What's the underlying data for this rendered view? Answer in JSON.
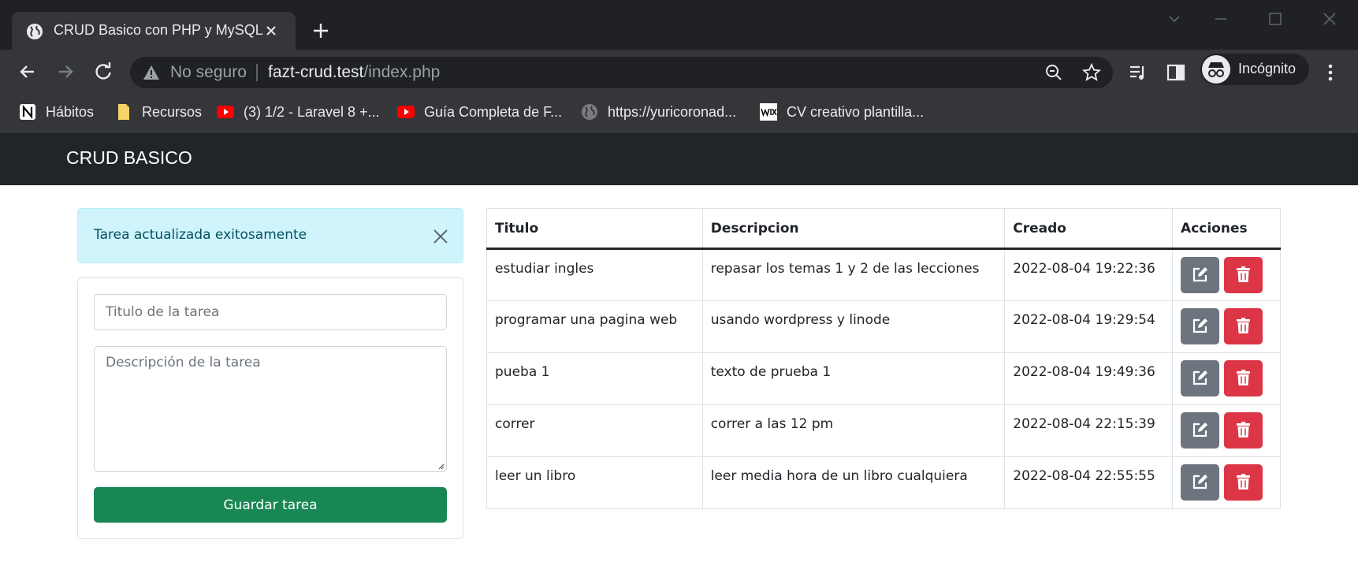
{
  "browser": {
    "tab_title": "CRUD Basico con PHP y MySQL",
    "security_label": "No seguro",
    "url_host": "fazt-crud.test",
    "url_path": "/index.php",
    "profile_label": "Incógnito",
    "bookmarks": [
      {
        "label": "Hábitos",
        "icon": "notion-icon"
      },
      {
        "label": "Recursos",
        "icon": "folder-icon"
      },
      {
        "label": "(3) 1/2 - Laravel 8 +...",
        "icon": "youtube-icon"
      },
      {
        "label": "Guía Completa de F...",
        "icon": "youtube-icon"
      },
      {
        "label": "https://yuricoronad...",
        "icon": "globe-icon"
      },
      {
        "label": "CV creativo plantilla...",
        "icon": "wix-icon"
      }
    ]
  },
  "navbar": {
    "brand": "CRUD BASICO"
  },
  "alert": {
    "message": "Tarea actualizada exitosamente"
  },
  "form": {
    "title_placeholder": "Titulo de la tarea",
    "title_value": "",
    "description_placeholder": "Descripción de la tarea",
    "description_value": "",
    "submit_label": "Guardar tarea"
  },
  "table": {
    "headers": [
      "Titulo",
      "Descripcion",
      "Creado",
      "Acciones"
    ],
    "rows": [
      {
        "title": "estudiar ingles",
        "description": "repasar los temas 1 y 2 de las lecciones",
        "created": "2022-08-04 19:22:36"
      },
      {
        "title": "programar una pagina web",
        "description": "usando wordpress y linode",
        "created": "2022-08-04 19:29:54"
      },
      {
        "title": "pueba 1",
        "description": "texto de prueba 1",
        "created": "2022-08-04 19:49:36"
      },
      {
        "title": "correr",
        "description": "correr a las 12 pm",
        "created": "2022-08-04 22:15:39"
      },
      {
        "title": "leer un libro",
        "description": "leer media hora de un libro cualquiera",
        "created": "2022-08-04 22:55:55"
      }
    ]
  },
  "colors": {
    "navbar_bg": "#212529",
    "alert_bg": "#cff4fc",
    "save_button": "#198754",
    "edit_button": "#6c757d",
    "delete_button": "#dc3545"
  }
}
